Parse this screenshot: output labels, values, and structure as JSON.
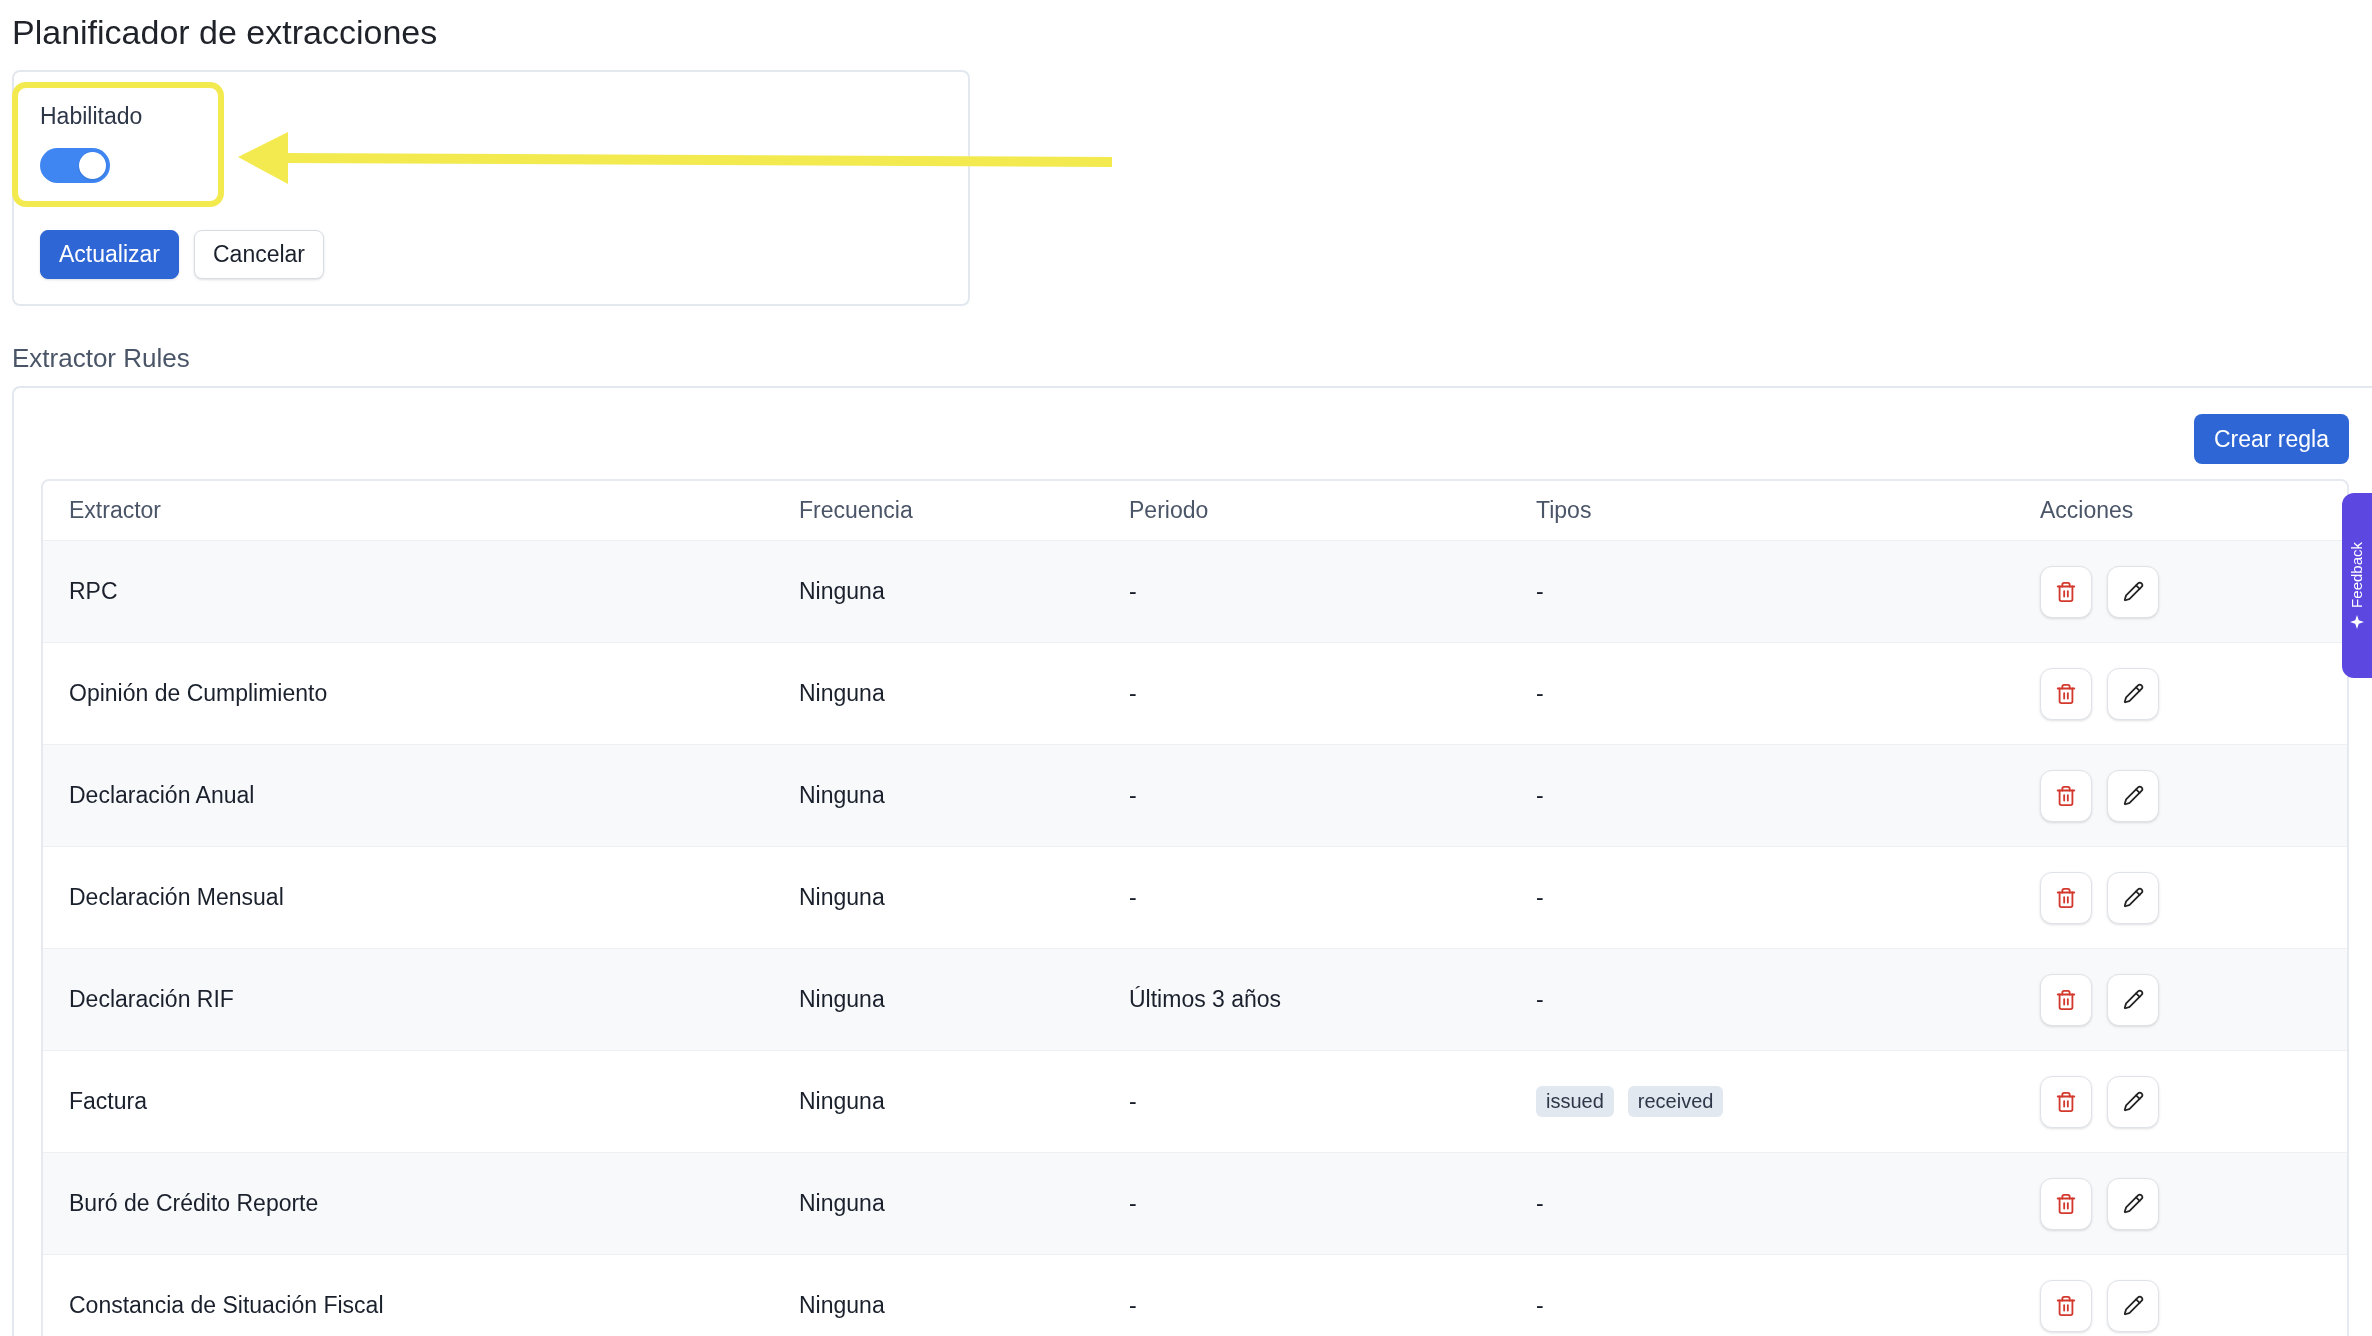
{
  "page": {
    "title": "Planificador de extracciones"
  },
  "scheduler_card": {
    "enabled_label": "Habilitado",
    "enabled": true,
    "buttons": [
      {
        "label": "Actualizar",
        "kind": "primary"
      },
      {
        "label": "Cancelar",
        "kind": "secondary"
      }
    ]
  },
  "rules_section": {
    "title": "Extractor Rules",
    "create_button": "Crear regla",
    "table": {
      "columns": [
        "Extractor",
        "Frecuencia",
        "Periodo",
        "Tipos",
        "Acciones"
      ],
      "rows": [
        {
          "extractor": "RPC",
          "frequency": "Ninguna",
          "period": "-",
          "types": {
            "kind": "text",
            "text": "-"
          }
        },
        {
          "extractor": "Opinión de Cumplimiento",
          "frequency": "Ninguna",
          "period": "-",
          "types": {
            "kind": "text",
            "text": "-"
          }
        },
        {
          "extractor": "Declaración Anual",
          "frequency": "Ninguna",
          "period": "-",
          "types": {
            "kind": "text",
            "text": "-"
          }
        },
        {
          "extractor": "Declaración Mensual",
          "frequency": "Ninguna",
          "period": "-",
          "types": {
            "kind": "text",
            "text": "-"
          }
        },
        {
          "extractor": "Declaración RIF",
          "frequency": "Ninguna",
          "period": "Últimos 3 años",
          "types": {
            "kind": "text",
            "text": "-"
          }
        },
        {
          "extractor": "Factura",
          "frequency": "Ninguna",
          "period": "-",
          "types": {
            "kind": "tags",
            "items": [
              "issued",
              "received"
            ]
          }
        },
        {
          "extractor": "Buró de Crédito Reporte",
          "frequency": "Ninguna",
          "period": "-",
          "types": {
            "kind": "text",
            "text": "-"
          }
        },
        {
          "extractor": "Constancia de Situación Fiscal",
          "frequency": "Ninguna",
          "period": "-",
          "types": {
            "kind": "text",
            "text": "-"
          }
        }
      ]
    }
  },
  "feedback_tab": {
    "label": "Feedback"
  }
}
